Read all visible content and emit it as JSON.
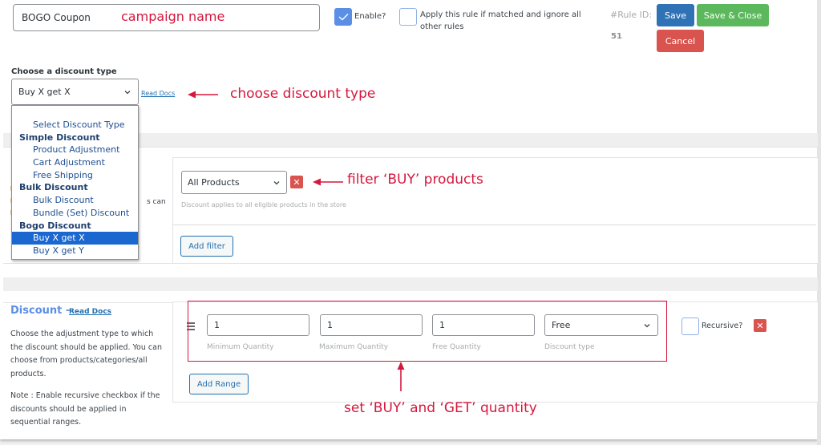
{
  "header": {
    "campaign_name_value": "BOGO Coupon",
    "enable_label": "Enable?",
    "enable_checked": true,
    "apply_rule_label": "Apply this rule if matched and ignore all other rules",
    "apply_rule_checked": false,
    "rule_id_label": "#Rule ID:",
    "rule_id_value": "51",
    "save_label": "Save",
    "save_close_label": "Save & Close",
    "cancel_label": "Cancel"
  },
  "discount_type": {
    "label": "Choose a discount type",
    "selected": "Buy X get X",
    "read_docs_label": "Read Docs",
    "options": [
      {
        "label": "Select Discount Type",
        "kind": "option"
      },
      {
        "label": "Simple Discount",
        "kind": "group"
      },
      {
        "label": "Product Adjustment",
        "kind": "option"
      },
      {
        "label": "Cart Adjustment",
        "kind": "option"
      },
      {
        "label": "Free Shipping",
        "kind": "option"
      },
      {
        "label": "Bulk Discount",
        "kind": "group"
      },
      {
        "label": "Bulk Discount",
        "kind": "option"
      },
      {
        "label": "Bundle (Set) Discount",
        "kind": "option"
      },
      {
        "label": "Bogo Discount",
        "kind": "group"
      },
      {
        "label": "Buy X get X",
        "kind": "option",
        "selected": true
      },
      {
        "label": "Buy X get Y",
        "kind": "option"
      }
    ]
  },
  "filter": {
    "partial_hidden_text": "s can",
    "select_value": "All Products",
    "hint": "Discount applies to all eligible products in the store",
    "add_filter_label": "Add filter"
  },
  "discount": {
    "title": "Discount",
    "dash": "-",
    "read_docs_label": "Read Docs",
    "description": "Choose the adjustment type to which the discount should be applied. You can choose from products/categories/all products.",
    "note": "Note : Enable recursive checkbox if the discounts should be applied in sequential ranges.",
    "range": {
      "min_quantity": "1",
      "max_quantity": "1",
      "free_quantity": "1",
      "discount_type": "Free",
      "min_label": "Minimum Quantity",
      "max_label": "Maximum Quantity",
      "free_label": "Free Quantity",
      "type_label": "Discount type"
    },
    "recursive_label": "Recursive?",
    "recursive_checked": false,
    "add_range_label": "Add Range"
  },
  "annotations": {
    "campaign_name": "campaign name",
    "choose_type": "choose discount type",
    "filter_buy": "filter ‘BUY’ products",
    "set_quantity": "set ‘BUY’ and ‘GET’ quantity"
  },
  "colors": {
    "primary": "#2f73b6",
    "success": "#5cb85c",
    "danger": "#d9534f",
    "annotation": "#d6173d",
    "checkbox_checked": "#5b8fe6",
    "dropdown_selected": "#1b67d0"
  }
}
